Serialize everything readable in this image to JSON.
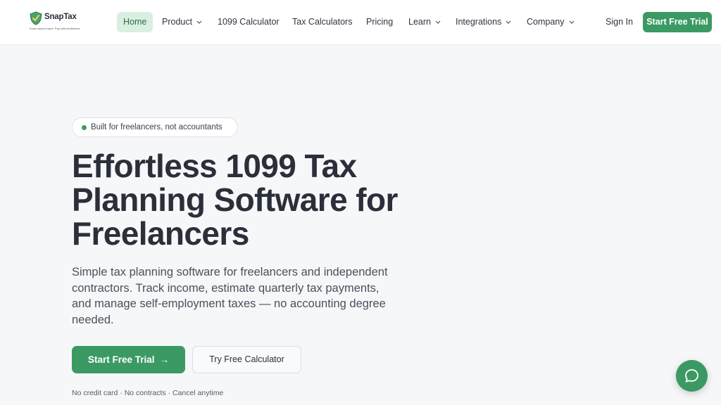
{
  "brand": {
    "name": "SnapTax",
    "tagline": "Know what to save. Pay with confidence.",
    "accent": "#3b9a63"
  },
  "nav": {
    "items": [
      {
        "label": "Home",
        "active": true,
        "dropdown": false
      },
      {
        "label": "Product",
        "dropdown": true
      },
      {
        "label": "1099 Calculator",
        "dropdown": false
      },
      {
        "label": "Tax Calculators",
        "dropdown": false
      },
      {
        "label": "Pricing",
        "dropdown": false
      },
      {
        "label": "Learn",
        "dropdown": true
      },
      {
        "label": "Integrations",
        "dropdown": true
      },
      {
        "label": "Company",
        "dropdown": true
      }
    ],
    "sign_in": "Sign In",
    "cta": "Start Free Trial"
  },
  "hero": {
    "badge": "Built for freelancers, not accountants",
    "title": "Effortless 1099 Tax Planning Software for Freelancers",
    "subtitle": "Simple tax planning software for freelancers and independent contractors. Track income, estimate quarterly tax payments, and manage self-employment taxes — no accounting degree needed.",
    "primary_cta": "Start Free Trial",
    "primary_cta_icon": "arrow-right-icon",
    "secondary_cta": "Try Free Calculator",
    "fineprint": "No credit card · No contracts · Cancel anytime"
  },
  "chat": {
    "icon": "chat-bubble-icon"
  }
}
